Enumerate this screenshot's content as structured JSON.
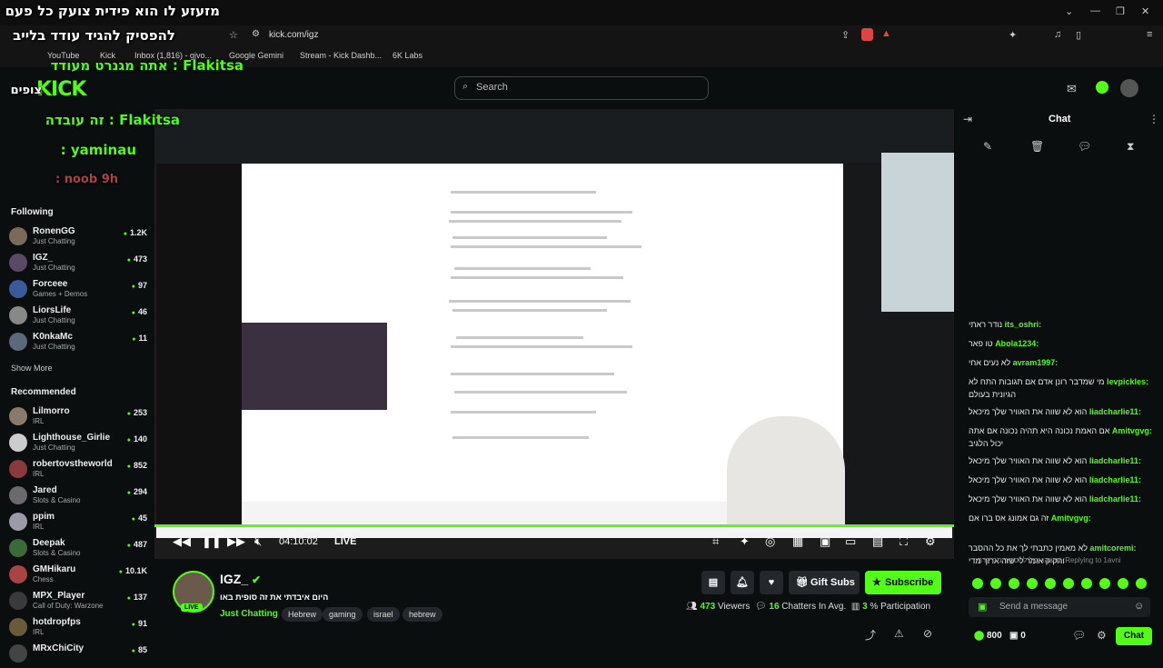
{
  "browser": {
    "url": "kick.com/igz",
    "bookmarks": [
      "YouTube",
      "Kick",
      "Inbox (1,816) - gjvo...",
      "Google Gemini",
      "Stream - Kick Dashb...",
      "6K Labs"
    ],
    "overlay_lines": [
      "מזעזע לו הוא פידית צועק כל פעם",
      "להפסיק להגיד עודד בלייב",
      "Flakitsa : אתה מגנרט מעודד",
      "צופים",
      "Flakitsa : זה עובדה",
      "yaminau :",
      "noob 9h :"
    ]
  },
  "header": {
    "logo": "KICK",
    "search_placeholder": "Search"
  },
  "sidebar": {
    "following_label": "Following",
    "following": [
      {
        "name": "RonenGG",
        "category": "Just Chatting",
        "viewers": "1.2K",
        "color": "#7a6a5a"
      },
      {
        "name": "IGZ_",
        "category": "Just Chatting",
        "viewers": "473",
        "color": "#5a4a66"
      },
      {
        "name": "Forceee",
        "category": "Games + Demos",
        "viewers": "97",
        "color": "#3a5a9a"
      },
      {
        "name": "LiorsLife",
        "category": "Just Chatting",
        "viewers": "46",
        "color": "#888888"
      },
      {
        "name": "K0nkaMc",
        "category": "Just Chatting",
        "viewers": "11",
        "color": "#5a6a7a"
      }
    ],
    "show_more": "Show More",
    "recommended_label": "Recommended",
    "recommended": [
      {
        "name": "Lilmorro",
        "category": "IRL",
        "viewers": "253",
        "color": "#8a7a6a"
      },
      {
        "name": "Lighthouse_Girlie",
        "category": "Just Chatting",
        "viewers": "140",
        "color": "#cccccc"
      },
      {
        "name": "robertovstheworld",
        "category": "IRL",
        "viewers": "852",
        "color": "#8a3a3a"
      },
      {
        "name": "Jared",
        "category": "Slots & Casino",
        "viewers": "294",
        "color": "#6a6a6a"
      },
      {
        "name": "ppim",
        "category": "IRL",
        "viewers": "45",
        "color": "#9a9aaa"
      },
      {
        "name": "Deepak",
        "category": "Slots & Casino",
        "viewers": "487",
        "color": "#3a6a3a"
      },
      {
        "name": "GMHikaru",
        "category": "Chess",
        "viewers": "10.1K",
        "color": "#aa4444"
      },
      {
        "name": "MPX_Player",
        "category": "Call of Duty: Warzone",
        "viewers": "137",
        "color": "#3a3a3a"
      },
      {
        "name": "hotdropfps",
        "category": "IRL",
        "viewers": "91",
        "color": "#6a5a3a"
      },
      {
        "name": "MRxChiCity",
        "category": "",
        "viewers": "85",
        "color": "#444444"
      }
    ]
  },
  "player": {
    "time": "04:10:02",
    "live_label": "LIVE"
  },
  "stream": {
    "streamer": "IGZ_",
    "live_badge": "LIVE",
    "title": "היום איבדתי את זה סופית באו",
    "category": "Just Chatting",
    "tags": [
      "Hebrew",
      "gaming",
      "israel",
      "hebrew"
    ],
    "gift_subs": "Gift Subs",
    "subscribe": "Subscribe",
    "viewers": "473",
    "viewers_label": "Viewers",
    "chatters": "16",
    "chatters_label": "Chatters In Avg.",
    "participation": "3",
    "participation_label": "% Participation"
  },
  "chat": {
    "title": "Chat",
    "messages": [
      {
        "user": "its_oshri:",
        "text": "נודר ראתי"
      },
      {
        "user": "Abola1234:",
        "text": "טו פאר"
      },
      {
        "user": "avram1997:",
        "text": "לא נעים אחי"
      },
      {
        "user": "levpickles:",
        "text": "מי שמדבר רונן אדם אם תגובות התח לא הגיונית בעולם"
      },
      {
        "user": "liadcharlie11:",
        "text": "הוא לא שווה את האוויר שלך מיכאל"
      },
      {
        "user": "Amitvgvg:",
        "text": "אם האמת נכונה היא תהיה נכונה אם אתה יכול הלגיב"
      },
      {
        "user": "liadcharlie11:",
        "text": "הוא לא שווה את האוויר שלך מיכאל"
      },
      {
        "user": "liadcharlie11:",
        "text": "הוא לא שווה את האוויר שלך מיכאל"
      },
      {
        "user": "liadcharlie11:",
        "text": "הוא לא שווה את האוויר שלך מיכאל"
      },
      {
        "user": "Amitvgvg:",
        "text": "זה גם אמונג אס ברו אם"
      },
      {
        "user": "amitcoremi:",
        "text": "לא מאמין כתבתי לך את כל ההסבר והקיק אומר לי שזה ארוך מדי"
      }
    ],
    "replying_note": "Replying to 1avni: מישהו יכול להסביר מה קרה",
    "input_placeholder": "Send a message",
    "points": "800",
    "gifts": "0",
    "chat_button": "Chat"
  }
}
